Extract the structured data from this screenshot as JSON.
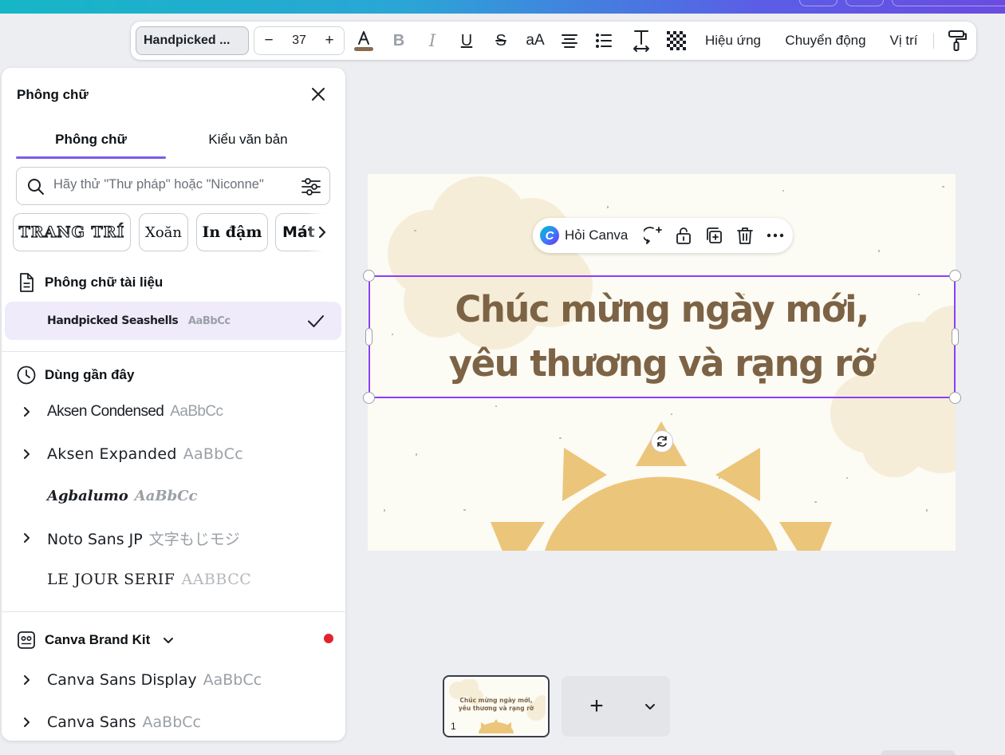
{
  "toolbar": {
    "font_name": "Handpicked ...",
    "decrease_label": "−",
    "font_size": "37",
    "increase_label": "+",
    "bold_label": "B",
    "italic_label": "I",
    "underline_label": "U",
    "strike_label": "S",
    "case_label": "aA",
    "effects_label": "Hiệu ứng",
    "animate_label": "Chuyển động",
    "position_label": "Vị trí",
    "text_color": "#8a6b4e"
  },
  "panel": {
    "title": "Phông chữ",
    "tabs": [
      {
        "label": "Phông chữ",
        "active": true
      },
      {
        "label": "Kiểu văn bản",
        "active": false
      }
    ],
    "search_placeholder": "Hãy thử \"Thư pháp\" hoặc \"Niconne\"",
    "chips": [
      "TRANG TRÍ",
      "Xoăn",
      "In đậm",
      "Mát m"
    ],
    "document_fonts": {
      "heading": "Phông chữ tài liệu",
      "items": [
        {
          "name": "Handpicked Seashells",
          "sample": "AaBbCc",
          "selected": true
        }
      ]
    },
    "recent": {
      "heading": "Dùng gần đây",
      "items": [
        {
          "name": "Aksen Condensed",
          "sample": "AaBbCc"
        },
        {
          "name": "Aksen Expanded",
          "sample": "AaBbCc"
        },
        {
          "name": "Agbalumo",
          "sample": "AaBbCc"
        },
        {
          "name": "Noto Sans JP",
          "sample": "文字もじモジ"
        },
        {
          "name": "LE JOUR SERIF",
          "sample": "AABBCC"
        }
      ]
    },
    "brand_kit": {
      "heading": "Canva Brand Kit",
      "items": [
        {
          "name": "Canva Sans Display",
          "sample": "AaBbCc"
        },
        {
          "name": "Canva Sans",
          "sample": "AaBbCc"
        }
      ]
    }
  },
  "canvas": {
    "headline_line1": "Chúc mừng ngày mới,",
    "headline_line2": "yêu thương và rạng rỡ",
    "bg_color": "#fcfbf4",
    "sun_color": "#ebc57a",
    "cloud_color": "#f6edd8",
    "text_color": "#7d6345"
  },
  "context_bar": {
    "ask_label": "Hỏi Canva",
    "logo_letter": "C"
  },
  "pages": {
    "thumb_line1": "Chúc mừng ngày mới,",
    "thumb_line2": "yêu thương và rạng rỡ",
    "page_number": "1",
    "add_label": "+"
  },
  "colors": {
    "accent": "#7d5ce8",
    "selection": "#8b3dff",
    "notification_dot": "#e0242f"
  }
}
